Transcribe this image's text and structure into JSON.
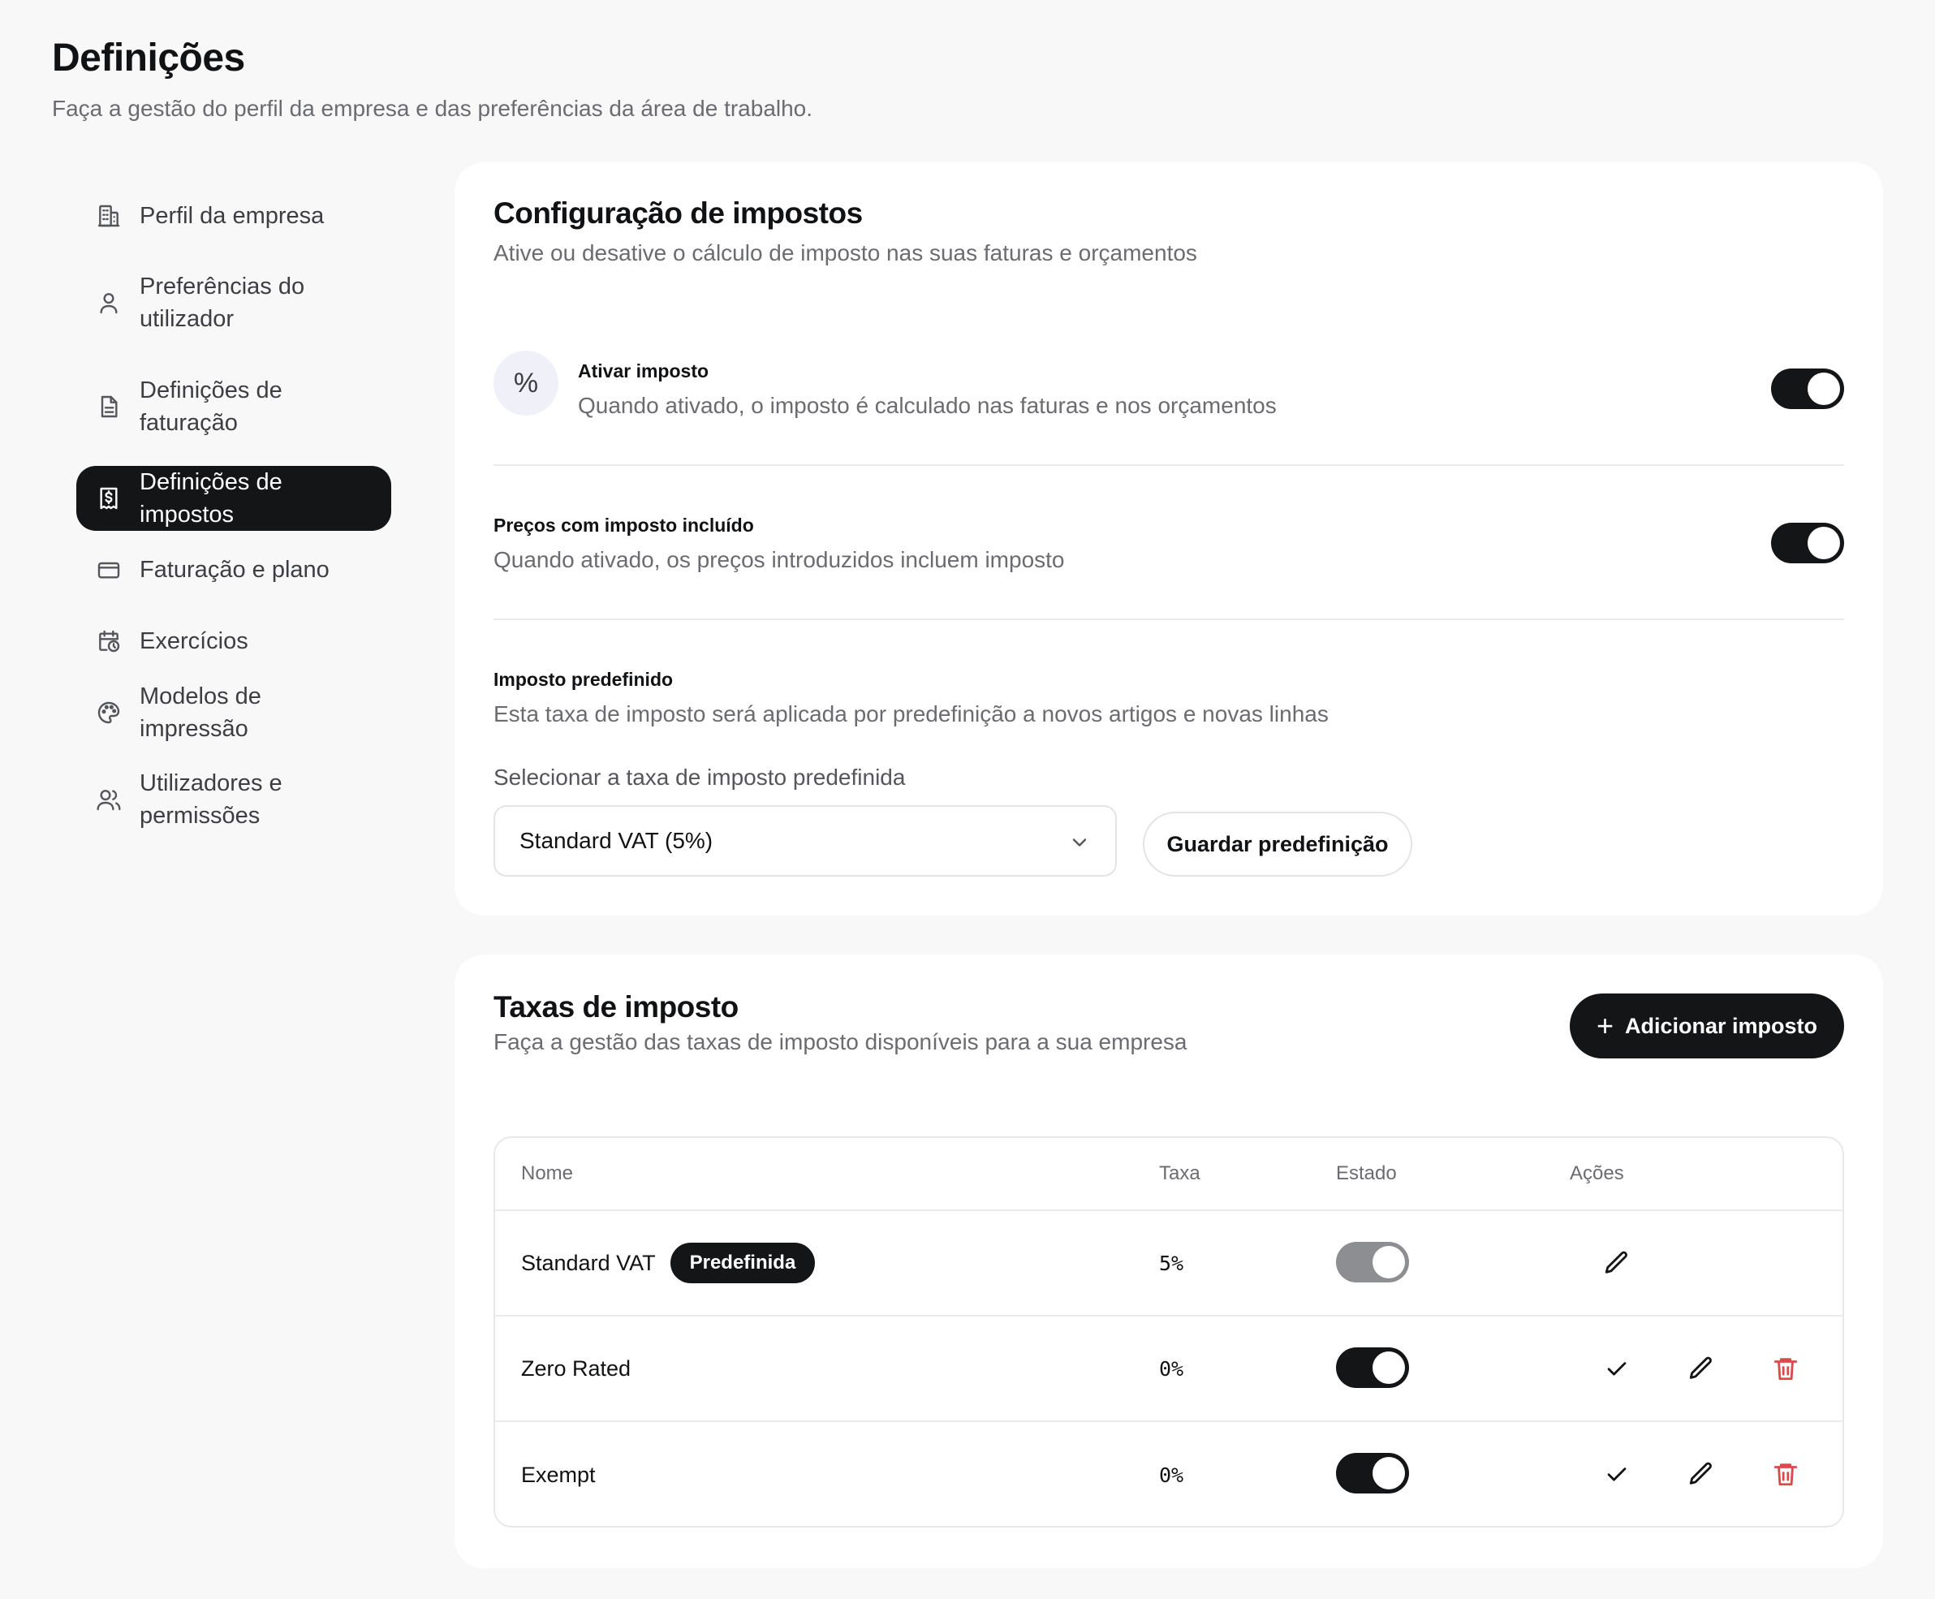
{
  "page": {
    "title": "Definições",
    "subtitle": "Faça a gestão do perfil da empresa e das preferências da área de trabalho."
  },
  "sidebar": {
    "items": [
      {
        "label": "Perfil da empresa",
        "icon": "building-icon"
      },
      {
        "label": "Preferências do utilizador",
        "icon": "user-icon"
      },
      {
        "label": "Definições de faturação",
        "icon": "document-icon"
      },
      {
        "label": "Definições de impostos",
        "icon": "receipt-icon",
        "active": true
      },
      {
        "label": "Faturação e plano",
        "icon": "credit-card-icon"
      },
      {
        "label": "Exercícios",
        "icon": "calendar-clock-icon"
      },
      {
        "label": "Modelos de impressão",
        "icon": "palette-icon"
      },
      {
        "label": "Utilizadores e permissões",
        "icon": "users-icon"
      }
    ]
  },
  "tax_config": {
    "title": "Configuração de impostos",
    "subtitle": "Ative ou desative o cálculo de imposto nas suas faturas e orçamentos",
    "enable_tax": {
      "icon_glyph": "%",
      "label": "Ativar imposto",
      "description": "Quando ativado, o imposto é calculado nas faturas e nos orçamentos",
      "enabled": true
    },
    "tax_inclusive": {
      "label": "Preços com imposto incluído",
      "description": "Quando ativado, os preços introduzidos incluem imposto",
      "enabled": true
    },
    "default_tax": {
      "label": "Imposto predefinido",
      "description": "Esta taxa de imposto será aplicada por predefinição a novos artigos e novas linhas",
      "select_label": "Selecionar a taxa de imposto predefinida",
      "selected_value": "Standard VAT (5%)",
      "save_button": "Guardar predefinição"
    }
  },
  "tax_rates": {
    "title": "Taxas de imposto",
    "subtitle": "Faça a gestão das taxas de imposto disponíveis para a sua empresa",
    "add_button": "Adicionar imposto",
    "add_button_glyph": "+",
    "columns": [
      "Nome",
      "Taxa",
      "Estado",
      "Ações"
    ],
    "rows": [
      {
        "name": "Standard VAT",
        "badge": "Predefinida",
        "rate": "5%",
        "active": true,
        "is_default": true
      },
      {
        "name": "Zero Rated",
        "badge": "",
        "rate": "0%",
        "active": true,
        "is_default": false
      },
      {
        "name": "Exempt",
        "badge": "",
        "rate": "0%",
        "active": true,
        "is_default": false
      }
    ]
  },
  "colors": {
    "accent": "#141517",
    "danger": "#d94a4a",
    "muted_toggle": "#8d8e92",
    "background": "#f8f8f9"
  }
}
